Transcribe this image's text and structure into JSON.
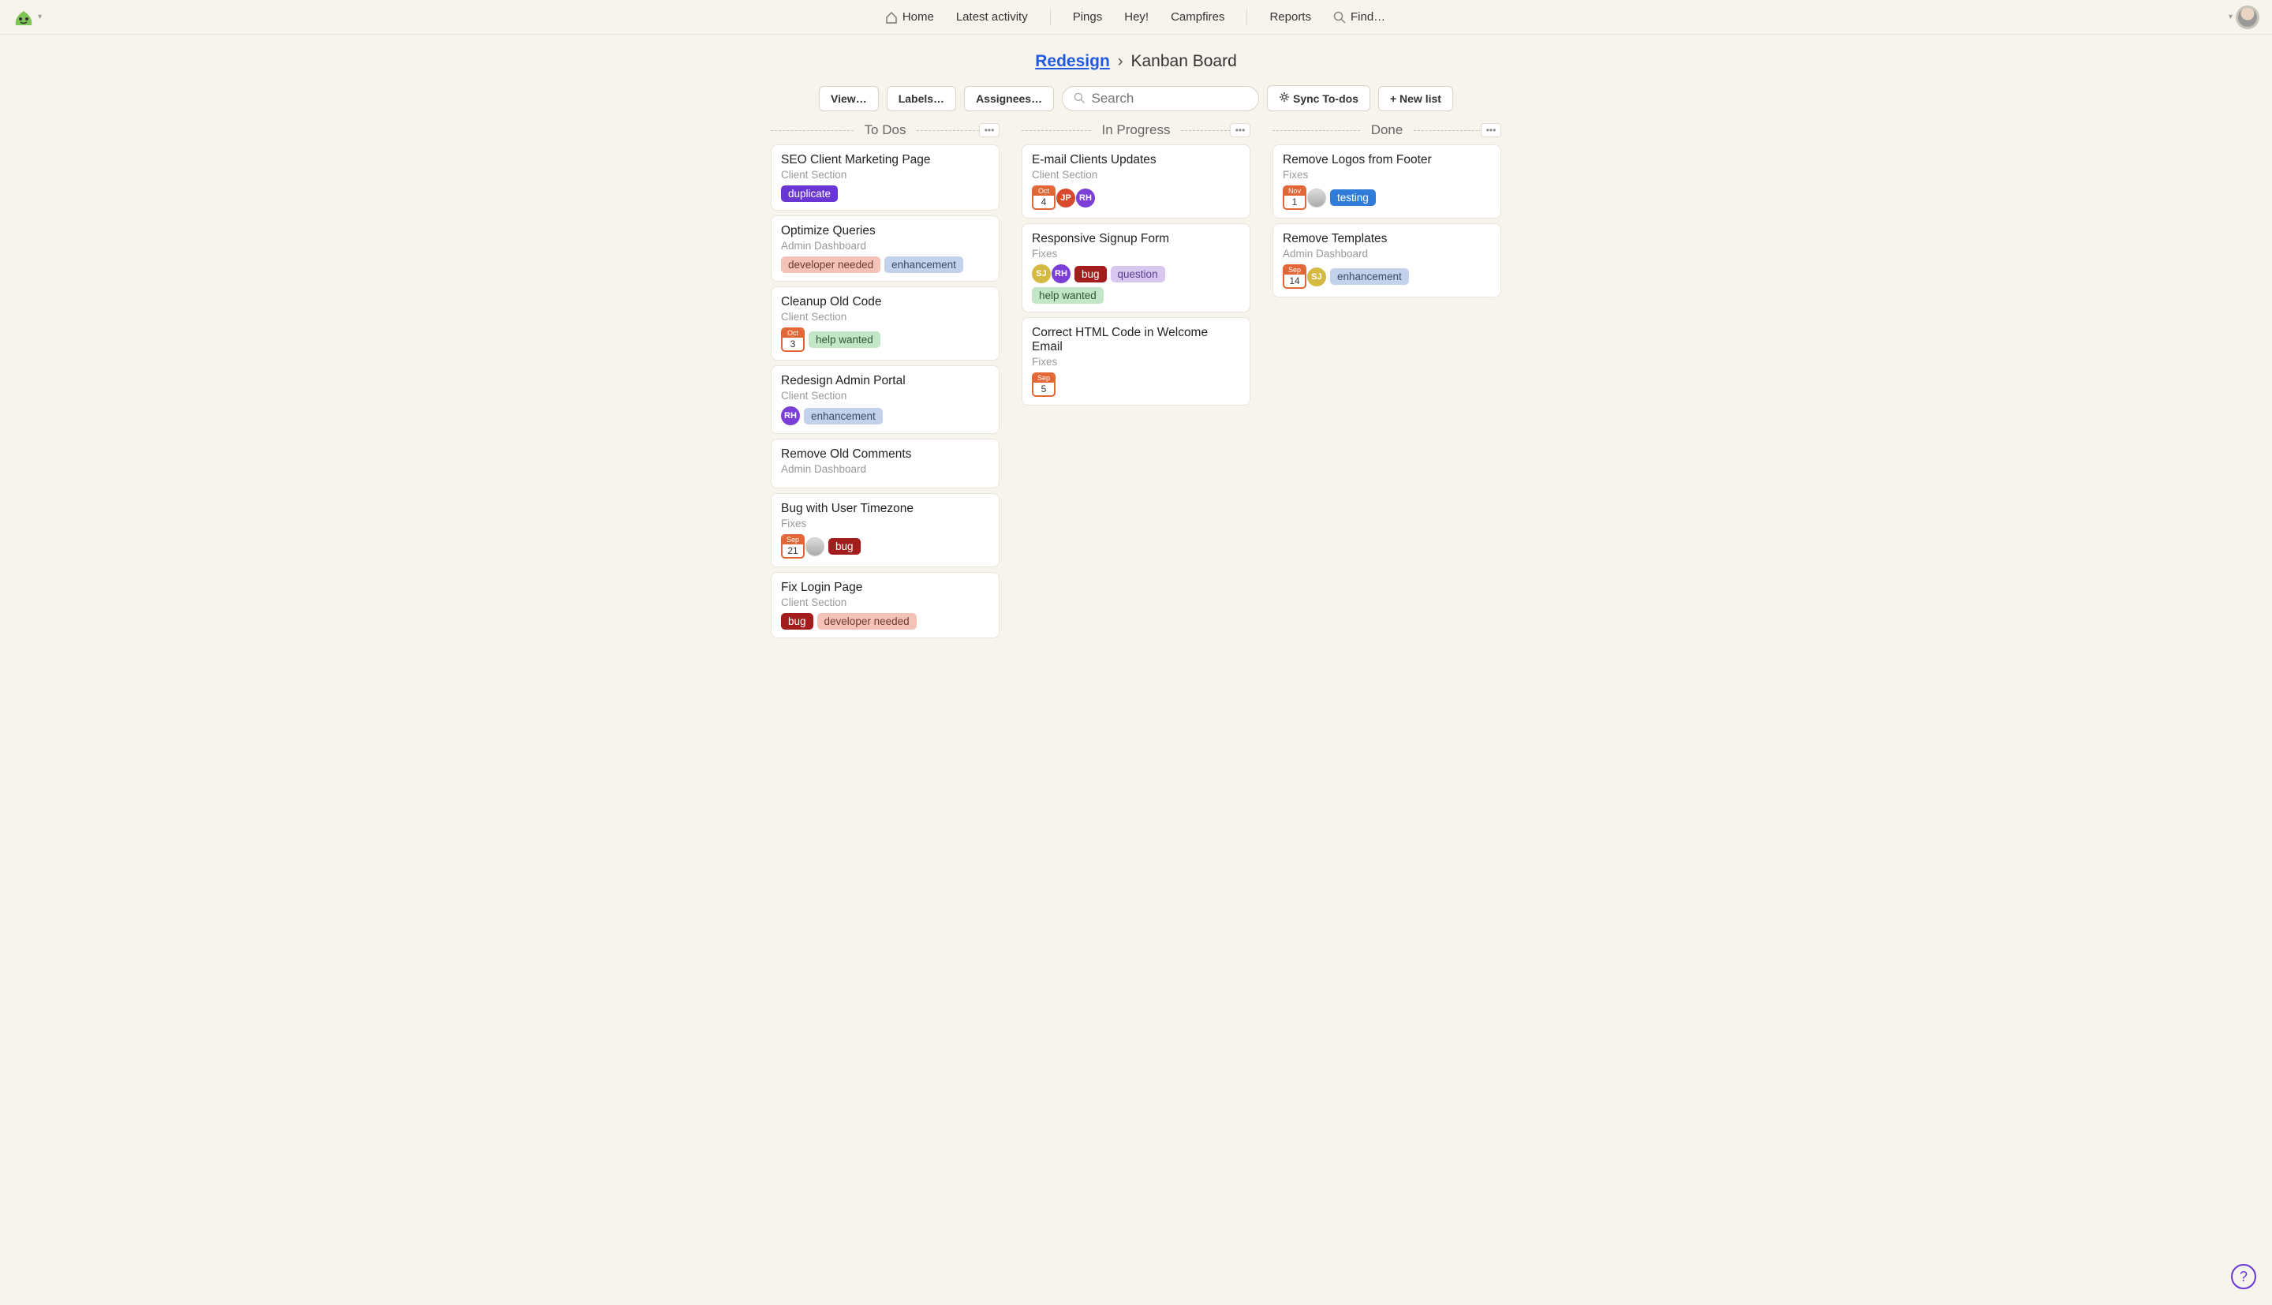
{
  "nav": {
    "home": "Home",
    "latest_activity": "Latest activity",
    "pings": "Pings",
    "hey": "Hey!",
    "campfires": "Campfires",
    "reports": "Reports",
    "find": "Find…"
  },
  "breadcrumb": {
    "parent": "Redesign",
    "sep": "›",
    "current": "Kanban Board"
  },
  "toolbar": {
    "view": "View…",
    "labels": "Labels…",
    "assignees": "Assignees…",
    "search_placeholder": "Search",
    "sync": "Sync To-dos",
    "new_list": "+ New list"
  },
  "tags": {
    "duplicate": "duplicate",
    "developer_needed": "developer needed",
    "enhancement": "enhancement",
    "help_wanted": "help wanted",
    "bug": "bug",
    "question": "question",
    "testing": "testing"
  },
  "columns": [
    {
      "title": "To Dos",
      "cards": [
        {
          "title": "SEO Client Marketing Page",
          "sub": "Client Section",
          "date": null,
          "assignees": [],
          "tags": [
            "duplicate"
          ]
        },
        {
          "title": "Optimize Queries",
          "sub": "Admin Dashboard",
          "date": null,
          "assignees": [],
          "tags": [
            "developer_needed",
            "enhancement"
          ]
        },
        {
          "title": "Cleanup Old Code",
          "sub": "Client Section",
          "date": {
            "m": "Oct",
            "d": "3"
          },
          "assignees": [],
          "tags": [
            "help_wanted"
          ]
        },
        {
          "title": "Redesign Admin Portal",
          "sub": "Client Section",
          "date": null,
          "assignees": [
            "RH"
          ],
          "tags": [
            "enhancement"
          ]
        },
        {
          "title": "Remove Old Comments",
          "sub": "Admin Dashboard",
          "date": null,
          "assignees": [],
          "tags": []
        },
        {
          "title": "Bug with User Timezone",
          "sub": "Fixes",
          "date": {
            "m": "Sep",
            "d": "21"
          },
          "assignees": [
            "img"
          ],
          "tags": [
            "bug"
          ]
        },
        {
          "title": "Fix Login Page",
          "sub": "Client Section",
          "date": null,
          "assignees": [],
          "tags": [
            "bug",
            "developer_needed"
          ]
        }
      ]
    },
    {
      "title": "In Progress",
      "cards": [
        {
          "title": "E-mail Clients Updates",
          "sub": "Client Section",
          "date": {
            "m": "Oct",
            "d": "4"
          },
          "assignees": [
            "JP",
            "RH"
          ],
          "tags": []
        },
        {
          "title": "Responsive Signup Form",
          "sub": "Fixes",
          "date": null,
          "assignees": [
            "SJ",
            "RH"
          ],
          "tags": [
            "bug",
            "question"
          ],
          "tags2": [
            "help_wanted"
          ]
        },
        {
          "title": "Correct HTML Code in Welcome Email",
          "sub": "Fixes",
          "date": {
            "m": "Sep",
            "d": "5"
          },
          "assignees": [],
          "tags": []
        }
      ]
    },
    {
      "title": "Done",
      "cards": [
        {
          "title": "Remove Logos from Footer",
          "sub": "Fixes",
          "date": {
            "m": "Nov",
            "d": "1"
          },
          "assignees": [
            "img"
          ],
          "tags": [
            "testing"
          ]
        },
        {
          "title": "Remove Templates",
          "sub": "Admin Dashboard",
          "date": {
            "m": "Sep",
            "d": "14"
          },
          "assignees": [
            "SJ"
          ],
          "tags": [
            "enhancement"
          ]
        }
      ]
    }
  ],
  "help": "?"
}
